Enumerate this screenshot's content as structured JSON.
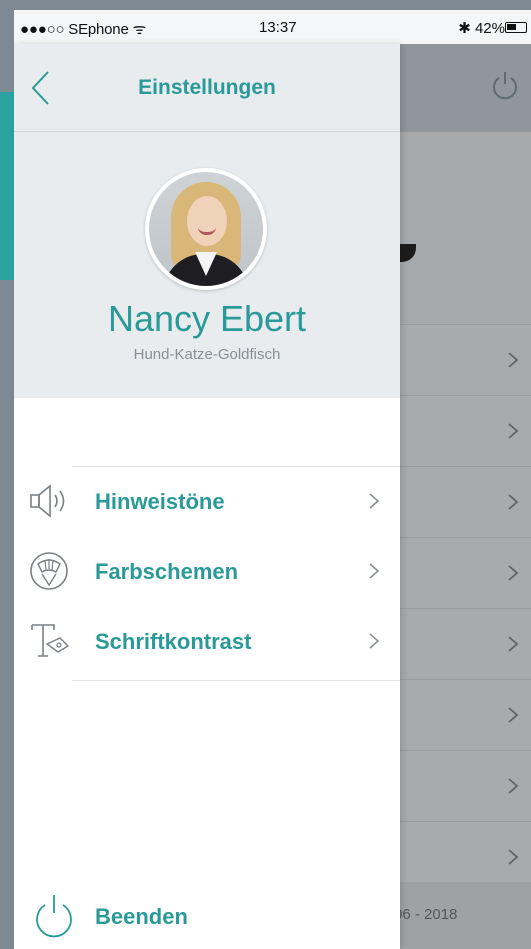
{
  "status_bar": {
    "carrier": "●●●○○ SEphone",
    "time": "13:37",
    "battery_text": "42%"
  },
  "drawer": {
    "title": "Einstellungen",
    "profile": {
      "name": "Nancy Ebert",
      "subtitle": "Hund-Katze-Goldfisch"
    },
    "menu": [
      {
        "label": "Hinweistöne",
        "icon": "speaker-icon"
      },
      {
        "label": "Farbschemen",
        "icon": "palette-icon"
      },
      {
        "label": "Schriftkontrast",
        "icon": "font-contrast-icon"
      }
    ],
    "logout_label": "Beenden"
  },
  "background": {
    "footer_text": "06 - 2018"
  },
  "colors": {
    "accent": "#2a9a98",
    "header_bg": "#e8ecef",
    "overlay": "#a8aaad"
  }
}
